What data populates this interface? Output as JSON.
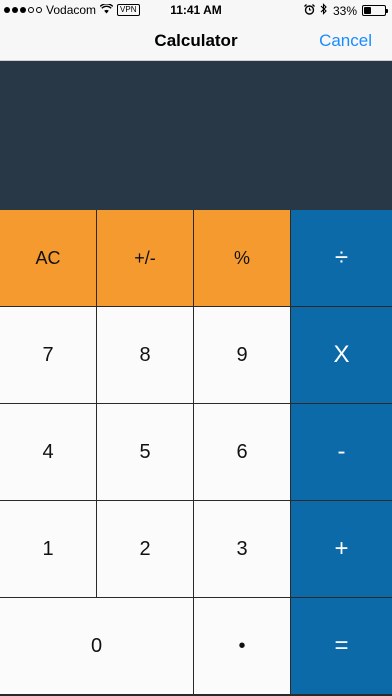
{
  "status_bar": {
    "carrier": "Vodacom",
    "vpn": "VPN",
    "time": "11:41 AM",
    "battery": "33%",
    "battery_level": 0.33,
    "signal_bars": 3,
    "signal_total": 5
  },
  "nav": {
    "title": "Calculator",
    "cancel": "Cancel"
  },
  "display": {
    "value": ""
  },
  "keys": {
    "ac": "AC",
    "sign": "+/-",
    "percent": "%",
    "divide": "÷",
    "seven": "7",
    "eight": "8",
    "nine": "9",
    "multiply": "X",
    "four": "4",
    "five": "5",
    "six": "6",
    "minus": "-",
    "one": "1",
    "two": "2",
    "three": "3",
    "plus": "+",
    "zero": "0",
    "decimal": "•",
    "equals": "="
  },
  "colors": {
    "function_key": "#f59a2e",
    "operator_key": "#0d6aa8",
    "display_bg": "#283847",
    "accent": "#1a8cff"
  }
}
